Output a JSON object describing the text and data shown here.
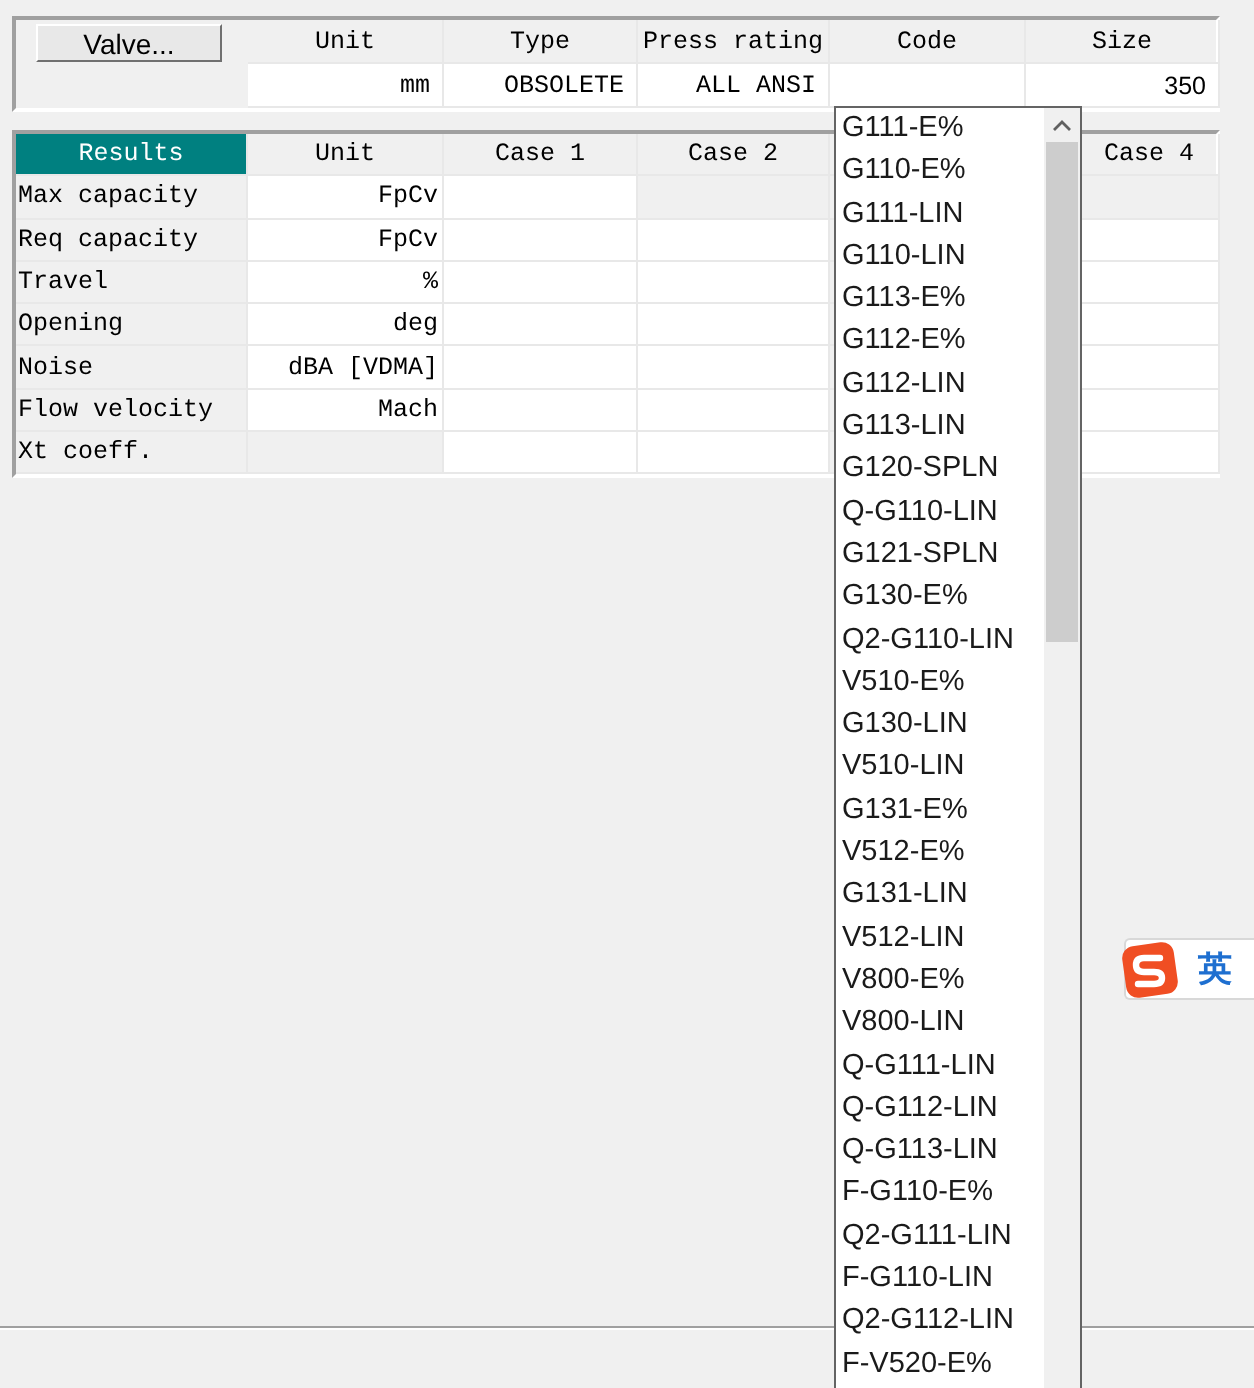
{
  "valve_panel": {
    "button": "Valve...",
    "headers": [
      "Unit",
      "Type",
      "Press rating",
      "Code",
      "Size"
    ],
    "values": {
      "unit": "mm",
      "type": "OBSOLETE",
      "press_rating": "ALL ANSI",
      "size": "350"
    }
  },
  "results": {
    "header": {
      "label": "Results",
      "selected": true
    },
    "columns": [
      "Unit",
      "Case 1",
      "Case 2",
      "Case 4"
    ],
    "rows": [
      {
        "label": "Max capacity",
        "unit": "FpCv",
        "unit_disabled": false,
        "case_disabled": [
          false,
          true,
          true
        ]
      },
      {
        "label": "Req capacity",
        "unit": "FpCv",
        "unit_disabled": false,
        "case_disabled": [
          false,
          false,
          false
        ]
      },
      {
        "label": "Travel",
        "unit": "%",
        "unit_disabled": false,
        "case_disabled": [
          false,
          false,
          false
        ]
      },
      {
        "label": "Opening",
        "unit": "deg",
        "unit_disabled": false,
        "case_disabled": [
          false,
          false,
          false
        ]
      },
      {
        "label": "Noise",
        "unit": "dBA [VDMA]",
        "unit_disabled": false,
        "case_disabled": [
          false,
          false,
          false
        ]
      },
      {
        "label": "Flow velocity",
        "unit": "Mach",
        "unit_disabled": false,
        "case_disabled": [
          false,
          false,
          false
        ]
      },
      {
        "label": "Xt coeff.",
        "unit": "",
        "unit_disabled": true,
        "case_disabled": [
          false,
          false,
          false
        ]
      }
    ]
  },
  "code_dropdown": {
    "items": [
      "G111-E%",
      "G110-E%",
      "G111-LIN",
      "G110-LIN",
      "G113-E%",
      "G112-E%",
      "G112-LIN",
      "G113-LIN",
      "G120-SPLN",
      "Q-G110-LIN",
      "G121-SPLN",
      "G130-E%",
      "Q2-G110-LIN",
      "V510-E%",
      "G130-LIN",
      "V510-LIN",
      "G131-E%",
      "V512-E%",
      "G131-LIN",
      "V512-LIN",
      "V800-E%",
      "V800-LIN",
      "Q-G111-LIN",
      "Q-G112-LIN",
      "Q-G113-LIN",
      "F-G110-E%",
      "Q2-G111-LIN",
      "F-G110-LIN",
      "Q2-G112-LIN",
      "F-V520-E%"
    ]
  },
  "ime_indicator": {
    "label": "英"
  }
}
